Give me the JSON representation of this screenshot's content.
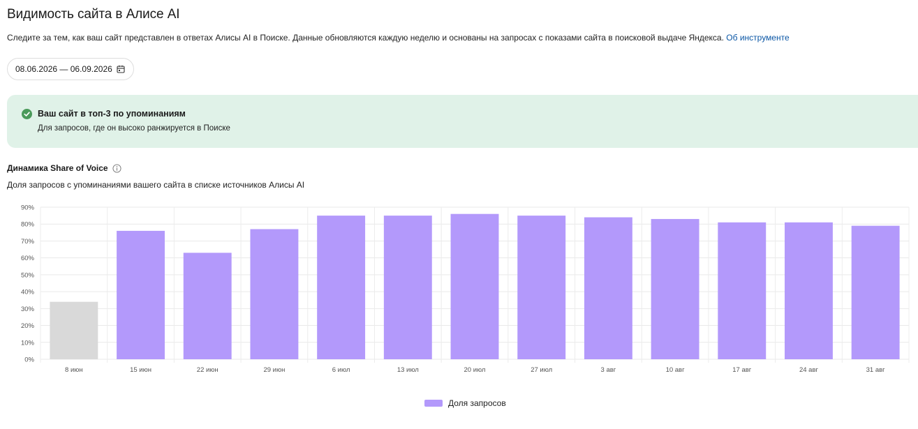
{
  "header": {
    "title": "Видимость сайта в Алисе AI",
    "description": "Следите за тем, как ваш сайт представлен в ответах Алисы AI в Поиске. Данные обновляются каждую неделю и основаны на запросах с показами сайта в поисковой выдаче Яндекса.",
    "about_link": "Об инструменте"
  },
  "date_range": {
    "value": "08.06.2026 — 06.09.2026",
    "icon": "calendar-icon"
  },
  "banner": {
    "title": "Ваш сайт в топ-3 по упоминаниям",
    "text": "Для запросов, где он высоко ранжируется в Поиске",
    "icon": "check-circle-icon"
  },
  "section": {
    "title": "Динамика Share of Voice",
    "subtitle": "Доля запросов с упоминаниями вашего сайта в списке источников Алисы AI"
  },
  "colors": {
    "bar": "#b399fb",
    "bar_inactive": "#d9d9d9",
    "banner_bg": "#e0f2e8",
    "accent": "#0a56a5",
    "check": "#4a9a5a"
  },
  "chart_data": {
    "type": "bar",
    "categories": [
      "8 июн",
      "15 июн",
      "22 июн",
      "29 июн",
      "6 июл",
      "13 июл",
      "20 июл",
      "27 июл",
      "3 авг",
      "10 авг",
      "17 авг",
      "24 авг",
      "31 авг"
    ],
    "series": [
      {
        "name": "Доля запросов",
        "values": [
          34,
          76,
          63,
          77,
          85,
          85,
          86,
          85,
          84,
          83,
          81,
          81,
          79
        ]
      }
    ],
    "inactive_categories": [
      "8 июн"
    ],
    "y_ticks": [
      "0%",
      "10%",
      "20%",
      "30%",
      "40%",
      "50%",
      "60%",
      "70%",
      "80%",
      "90%"
    ],
    "ylim": [
      0,
      90
    ],
    "grid": true,
    "legend": "bottom-center"
  }
}
